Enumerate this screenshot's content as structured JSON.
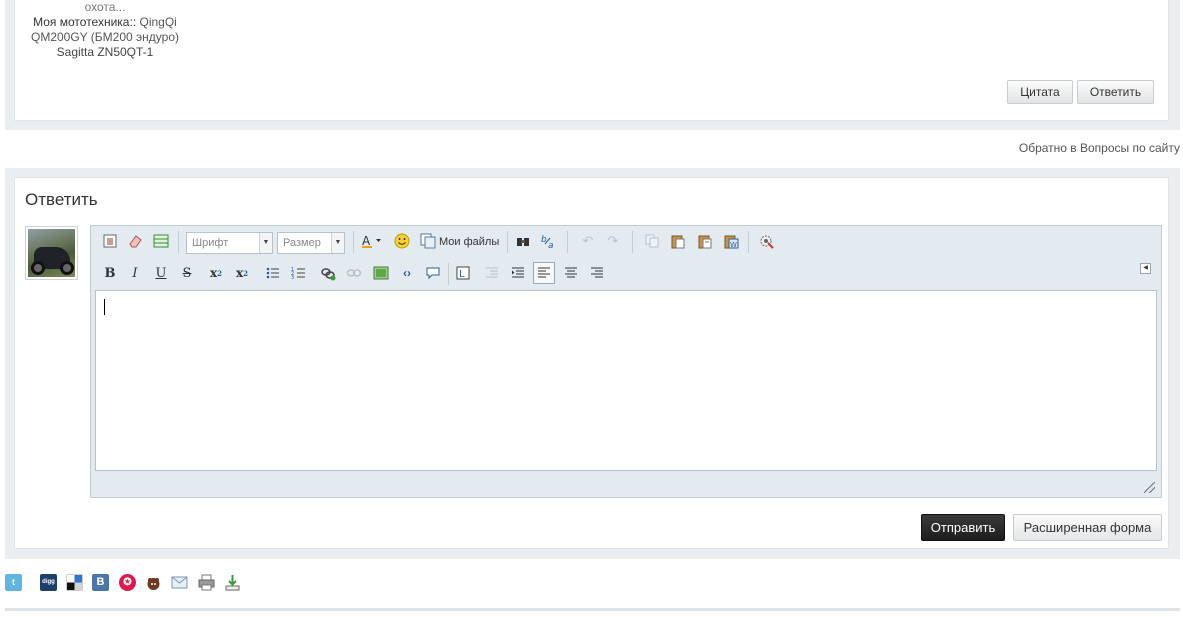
{
  "post": {
    "user_line1": "охота...",
    "moto_label": "Моя мототехника::",
    "moto_link1": "QingQi",
    "moto_link2": "QM200GY (БМ200 эндуро)",
    "moto_line3": "Sagitta ZN50QT-1",
    "quote_label": "Цитата",
    "reply_label": "Ответить"
  },
  "back_link": "Обратно в Вопросы по сайту",
  "reply": {
    "title": "Ответить",
    "editor": {
      "font_placeholder": "Шрифт",
      "size_placeholder": "Размер",
      "my_files_label": "Мои файлы"
    },
    "submit_label": "Отправить",
    "extended_label": "Расширенная форма"
  },
  "share_icons": [
    "twitter-icon",
    "digg-icon",
    "delicious-icon",
    "vkontakte-icon",
    "favorites-icon",
    "moikrug-icon",
    "email-icon",
    "print-icon",
    "download-icon"
  ],
  "colors": {
    "page_bg": "#ffffff",
    "block_bg": "#ebeef0",
    "editor_bg": "#e3eaf0",
    "submit_bg": "#222222"
  }
}
